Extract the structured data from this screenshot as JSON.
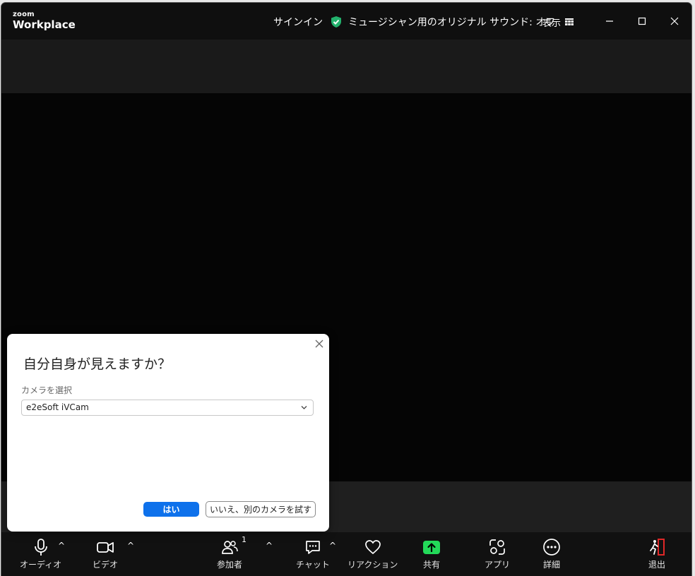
{
  "titlebar": {
    "logo_small": "zoom",
    "logo_big": "Workplace",
    "signin": "サインイン",
    "sound_status": "ミュージシャン用のオリジナル サウンド: オフ",
    "view": "表示"
  },
  "dialog": {
    "title": "自分自身が見えますか？",
    "camera_label": "カメラを選択",
    "camera_value": "e2eSoft iVCam",
    "yes": "はい",
    "no": "いいえ、別のカメラを試す"
  },
  "toolbar": {
    "audio": "オーディオ",
    "video": "ビデオ",
    "participants": "参加者",
    "participants_count": "1",
    "chat": "チャット",
    "reactions": "リアクション",
    "share": "共有",
    "apps": "アプリ",
    "more": "詳細",
    "leave": "退出"
  },
  "colors": {
    "share_green": "#23d959",
    "shield_green": "#23b26d",
    "primary_blue": "#0e71eb",
    "leave_red": "#e02828"
  }
}
